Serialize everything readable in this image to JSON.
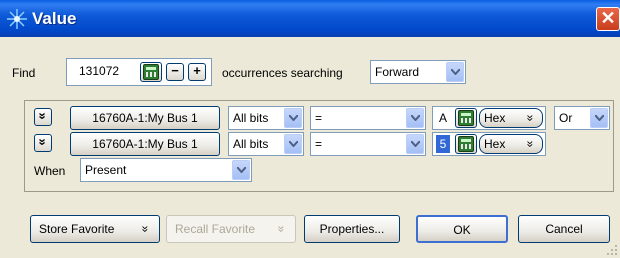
{
  "window": {
    "title": "Value",
    "close_glyph": "✕",
    "icon": "sparkle-icon"
  },
  "find": {
    "label": "Find",
    "count_value": "131072",
    "decrement_glyph": "−",
    "increment_glyph": "+",
    "occurrences_label": "occurrences searching",
    "direction_value": "Forward"
  },
  "rows": [
    {
      "expand_glyph": "»",
      "bus_label": "16760A-1:My Bus 1",
      "bits_value": "All bits",
      "operator_value": "=",
      "value_text": "A",
      "format_label": "Hex",
      "format_glyph": "»",
      "join_value": "Or"
    },
    {
      "expand_glyph": "»",
      "bus_label": "16760A-1:My Bus 1",
      "bits_value": "All bits",
      "operator_value": "=",
      "value_text": "5",
      "format_label": "Hex",
      "format_glyph": "»"
    }
  ],
  "when": {
    "label": "When",
    "value": "Present"
  },
  "footer": {
    "store_favorite_label": "Store Favorite",
    "store_glyph": "»",
    "recall_favorite_label": "Recall Favorite",
    "recall_glyph": "»",
    "properties_label": "Properties...",
    "ok_label": "OK",
    "cancel_label": "Cancel"
  },
  "colors": {
    "titlebar": "#0047c8",
    "dialog_bg": "#ece9d8",
    "value_highlight": "#3168d5",
    "close": "#c93d1c"
  }
}
